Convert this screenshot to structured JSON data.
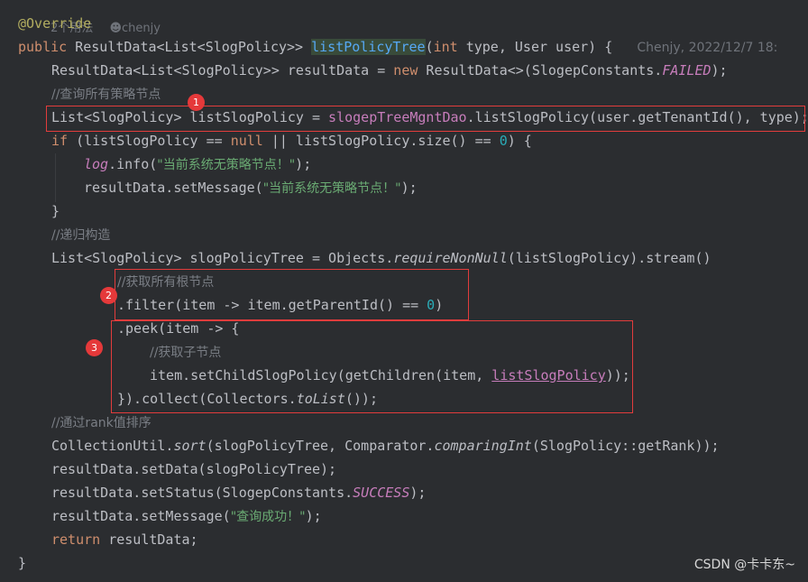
{
  "usage_hint": {
    "text": "2个用法",
    "author": "chenjy"
  },
  "code": {
    "annotation": "@Override",
    "signature": {
      "kw_public": "public",
      "return_type": "ResultData<List<SlogPolicy>>",
      "method_name": "listPolicyTree",
      "open": "(",
      "kw_int": "int",
      "params_rest": " type, User user) {",
      "blame": "Chenjy, 2022/12/7 18:"
    },
    "l3": {
      "a": "ResultData<List<SlogPolicy>> resultData = ",
      "kw_new": "new",
      "b": " ResultData<>(SlogepConstants.",
      "const": "FAILED",
      "c": ");"
    },
    "l4": {
      "comment": "//查询所有策略节点"
    },
    "l5": {
      "a": "List<SlogPolicy> listSlogPolicy = ",
      "field": "slogepTreeMgntDao",
      "b": ".listSlogPolicy(user.getTenantId(), type);"
    },
    "l6": {
      "kw_if": "if",
      "a": " (listSlogPolicy == ",
      "kw_null": "null",
      "b": " || listSlogPolicy.size() == ",
      "num": "0",
      "c": ") {"
    },
    "l7": {
      "log": "log",
      "a": ".info(",
      "str": "\"当前系统无策略节点！\"",
      "b": ");"
    },
    "l8": {
      "a": "resultData.setMessage(",
      "str": "\"当前系统无策略节点！\"",
      "b": ");"
    },
    "l9": {
      "a": "}"
    },
    "l10": {
      "comment": "//递归构造"
    },
    "l11": {
      "a": "List<SlogPolicy> slogPolicyTree = Objects.",
      "static": "requireNonNull",
      "b": "(listSlogPolicy).stream()"
    },
    "l12": {
      "comment": "//获取所有根节点"
    },
    "l13": {
      "a": ".filter(item -> item.getParentId() == ",
      "num": "0",
      "b": ")"
    },
    "l14": {
      "a": ".peek(item -> {"
    },
    "l15": {
      "comment": "//获取子节点"
    },
    "l16": {
      "a": "item.setChildSlogPolicy(getChildren(item, ",
      "captured": "listSlogPolicy",
      "b": "));"
    },
    "l17": {
      "a": "}).collect(Collectors.",
      "static": "toList",
      "b": "());"
    },
    "l18": {
      "comment": "//通过rank值排序"
    },
    "l19": {
      "a": "CollectionUtil.",
      "static1": "sort",
      "b": "(slogPolicyTree, Comparator.",
      "static2": "comparingInt",
      "c": "(SlogPolicy::getRank));"
    },
    "l20": {
      "a": "resultData.setData(slogPolicyTree);"
    },
    "l21": {
      "a": "resultData.setStatus(SlogepConstants.",
      "const": "SUCCESS",
      "b": ");"
    },
    "l22": {
      "a": "resultData.setMessage(",
      "str": "\"查询成功！\"",
      "b": ");"
    },
    "l23": {
      "kw_return": "return",
      "a": " resultData;"
    },
    "l24": {
      "a": "}"
    }
  },
  "markers": [
    "1",
    "2",
    "3"
  ],
  "watermark": "CSDN @卡卡东~",
  "colors": {
    "background": "#2b2d30",
    "highlight_box": "#e23c3c",
    "badge": "#e5393a"
  }
}
